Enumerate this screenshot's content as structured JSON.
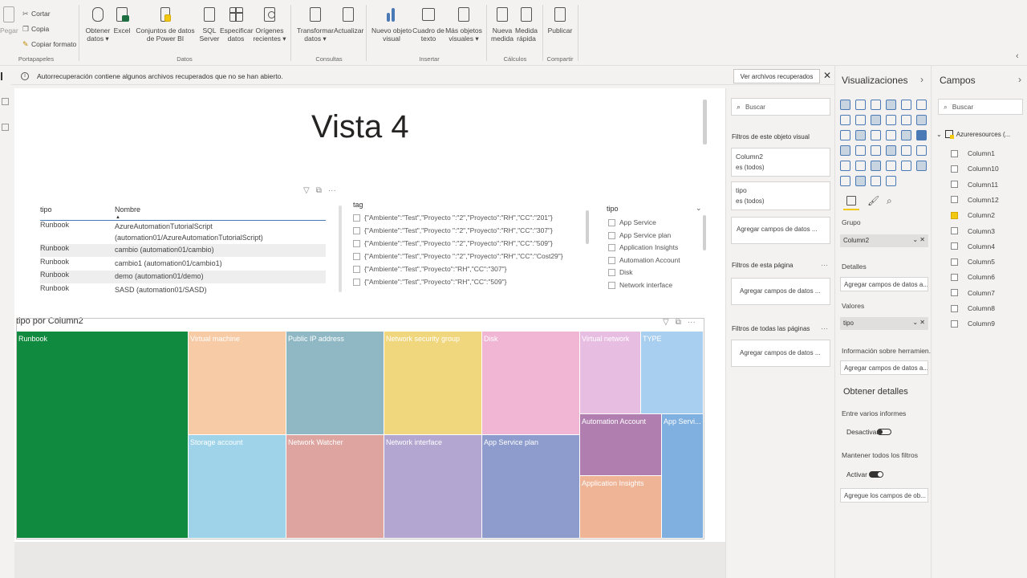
{
  "ribbon": {
    "paste_label": "Pegar",
    "clipboard": {
      "cut": "Cortar",
      "copy": "Copia",
      "format": "Copiar formato",
      "group": "Portapapeles"
    },
    "data_buttons": [
      {
        "label": "Obtener datos ▾"
      },
      {
        "label": "Excel"
      },
      {
        "label": "Conjuntos de datos de Power BI"
      },
      {
        "label": "SQL Server"
      },
      {
        "label": "Especificar datos"
      },
      {
        "label": "Orígenes recientes ▾"
      }
    ],
    "data_group": "Datos",
    "query_buttons": [
      {
        "label": "Transformar datos ▾"
      },
      {
        "label": "Actualizar"
      }
    ],
    "query_group": "Consultas",
    "insert_buttons": [
      {
        "label": "Nuevo objeto visual"
      },
      {
        "label": "Cuadro de texto"
      },
      {
        "label": "Más objetos visuales ▾"
      }
    ],
    "insert_group": "Insertar",
    "calc_buttons": [
      {
        "label": "Nueva medida"
      },
      {
        "label": "Medida rápida"
      }
    ],
    "calc_group": "Cálculos",
    "share_buttons": [
      {
        "label": "Publicar"
      }
    ],
    "share_group": "Compartir"
  },
  "infobar": {
    "message": "Autorrecuperación contiene algunos archivos recuperados que no se han abierto.",
    "button": "Ver archivos recuperados",
    "close": "✕"
  },
  "report": {
    "title": "Vista 4",
    "table": {
      "headers": [
        "tipo",
        "Nombre"
      ],
      "rows": [
        {
          "tipo": "Runbook",
          "nombre": "AzureAutomationTutorialScript",
          "nombre2": "(automation01/AzureAutomationTutorialScript)"
        },
        {
          "tipo": "Runbook",
          "nombre": "cambio (automation01/cambio)"
        },
        {
          "tipo": "Runbook",
          "nombre": "cambio1 (automation01/cambio1)"
        },
        {
          "tipo": "Runbook",
          "nombre": "demo (automation01/demo)"
        },
        {
          "tipo": "Runbook",
          "nombre": "SASD (automation01/SASD)"
        }
      ]
    },
    "tag_slicer": {
      "title": "tag",
      "items": [
        "{\"Ambiente\":\"Test\",\"Proyecto \":\"2\",\"Proyecto\":\"RH\",\"CC\":\"201\"}",
        "{\"Ambiente\":\"Test\",\"Proyecto \":\"2\",\"Proyecto\":\"RH\",\"CC\":\"307\"}",
        "{\"Ambiente\":\"Test\",\"Proyecto \":\"2\",\"Proyecto\":\"RH\",\"CC\":\"509\"}",
        "{\"Ambiente\":\"Test\",\"Proyecto \":\"2\",\"Proyecto\":\"RH\",\"CC\":\"Cost29\"}",
        "{\"Ambiente\":\"Test\",\"Proyecto\":\"RH\",\"CC\":\"307\"}",
        "{\"Ambiente\":\"Test\",\"Proyecto\":\"RH\",\"CC\":\"509\"}"
      ]
    },
    "tipo_slicer": {
      "title": "tipo",
      "items": [
        "App Service",
        "App Service plan",
        "Application Insights",
        "Automation Account",
        "Disk",
        "Network interface"
      ]
    },
    "treemap": {
      "title": "tipo por Column2",
      "tiles": [
        {
          "label": "Runbook",
          "color": "#0f8a3e"
        },
        {
          "label": "Virtual machine",
          "color": "#f7cba5"
        },
        {
          "label": "Public IP address",
          "color": "#8fb8c4"
        },
        {
          "label": "Network security group",
          "color": "#f0d67c"
        },
        {
          "label": "Disk",
          "color": "#f0b6d4"
        },
        {
          "label": "Virtual network",
          "color": "#e7bde2"
        },
        {
          "label": "TYPE",
          "color": "#a9cff0"
        },
        {
          "label": "Storage account",
          "color": "#9fd3ea"
        },
        {
          "label": "Network Watcher",
          "color": "#dea5a0"
        },
        {
          "label": "Network interface",
          "color": "#b3a6d1"
        },
        {
          "label": "App Service plan",
          "color": "#8d9ccc"
        },
        {
          "label": "Automation Account",
          "color": "#b07fb0"
        },
        {
          "label": "App Servi...",
          "color": "#7fb0e0"
        },
        {
          "label": "Application Insights",
          "color": "#efb496"
        }
      ]
    }
  },
  "filters": {
    "search_placeholder": "Buscar",
    "visual_title": "Filtros de este objeto visual",
    "cards": [
      {
        "name": "Column2",
        "value": "es (todos)"
      },
      {
        "name": "tipo",
        "value": "es (todos)"
      }
    ],
    "add_fields": "Agregar campos de datos ...",
    "page_title": "Filtros de esta página",
    "all_pages_title": "Filtros de todas las páginas",
    "dots": "···"
  },
  "visualizations": {
    "title": "Visualizaciones",
    "group_label": "Grupo",
    "group_value": "Column2",
    "details_label": "Detalles",
    "details_add": "Agregar campos de datos a...",
    "values_label": "Valores",
    "values_value": "tipo",
    "tooltips_label": "Información sobre herramien...",
    "tooltips_add": "Agregar campos de datos a...",
    "drillthrough_title": "Obtener detalles",
    "cross_report": "Entre varios informes",
    "cross_report_state": "Desactivar",
    "keep_filters": "Mantener todos los filtros",
    "keep_filters_state": "Activar",
    "drill_add": "Agregue los campos de ob..."
  },
  "fields": {
    "title": "Campos",
    "search_placeholder": "Buscar",
    "table_name": "Azureresources (...",
    "columns": [
      {
        "name": "Column1",
        "checked": false
      },
      {
        "name": "Column10",
        "checked": false
      },
      {
        "name": "Column11",
        "checked": false
      },
      {
        "name": "Column12",
        "checked": false
      },
      {
        "name": "Column2",
        "checked": true
      },
      {
        "name": "Column3",
        "checked": false
      },
      {
        "name": "Column4",
        "checked": false
      },
      {
        "name": "Column5",
        "checked": false
      },
      {
        "name": "Column6",
        "checked": false
      },
      {
        "name": "Column7",
        "checked": false
      },
      {
        "name": "Column8",
        "checked": false
      },
      {
        "name": "Column9",
        "checked": false
      }
    ]
  }
}
